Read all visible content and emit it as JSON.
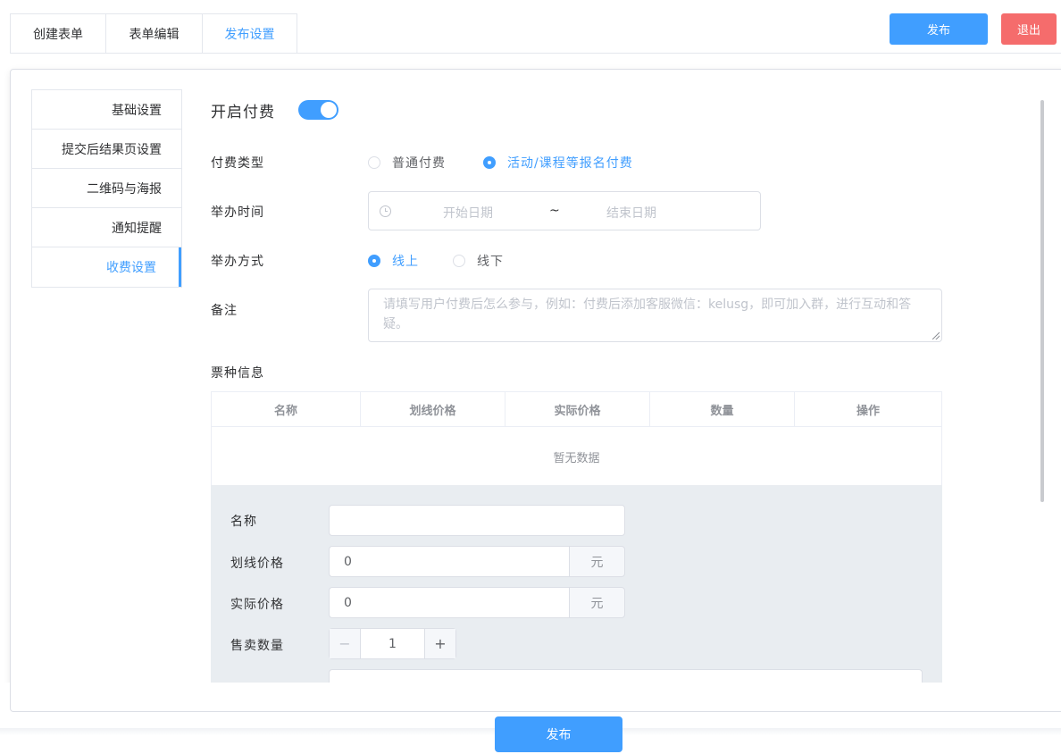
{
  "top_tabs": [
    "创建表单",
    "表单编辑",
    "发布设置"
  ],
  "actions": {
    "publish": "发布",
    "exit": "退出",
    "publish_bottom": "发布"
  },
  "side_menu": [
    "基础设置",
    "提交后结果页设置",
    "二维码与海报",
    "通知提醒",
    "收费设置"
  ],
  "form": {
    "enable_payment": {
      "label": "开启付费",
      "on": true
    },
    "payment_type": {
      "label": "付费类型",
      "options": [
        "普通付费",
        "活动/课程等报名付费"
      ],
      "selected": "活动/课程等报名付费"
    },
    "event_time": {
      "label": "举办时间",
      "start_placeholder": "开始日期",
      "separator": "~",
      "end_placeholder": "结束日期"
    },
    "event_mode": {
      "label": "举办方式",
      "options": [
        "线上",
        "线下"
      ],
      "selected": "线上"
    },
    "remarks": {
      "label": "备注",
      "placeholder": "请填写用户付费后怎么参与，例如：付费后添加客服微信：kelusg，即可加入群，进行互动和答疑。"
    },
    "ticket_info_label": "票种信息"
  },
  "ticket_table": {
    "columns": [
      "名称",
      "划线价格",
      "实际价格",
      "数量",
      "操作"
    ],
    "empty_text": "暂无数据"
  },
  "ticket_form": {
    "name_label": "名称",
    "name_value": "",
    "list_price_label": "划线价格",
    "list_price_value": "0",
    "actual_price_label": "实际价格",
    "actual_price_value": "0",
    "currency_unit": "元",
    "quantity_label": "售卖数量",
    "quantity_value": "1",
    "minus": "−",
    "plus": "+"
  },
  "colors": {
    "primary": "#409eff",
    "danger": "#f56c6c",
    "border": "#dcdfe6"
  }
}
